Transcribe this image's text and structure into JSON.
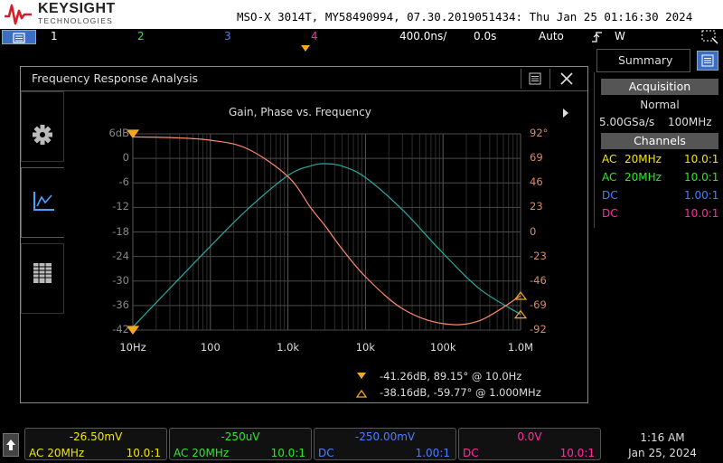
{
  "header": {
    "brand": "KEYSIGHT",
    "brand_sub": "TECHNOLOGIES",
    "title_line": "MSO-X 3014T, MY58490994, 07.30.2019051434: Thu Jan 25 01:16:30 2024"
  },
  "channel_bar": {
    "channels": [
      {
        "num": "1",
        "color": "#f2e700"
      },
      {
        "num": "2",
        "color": "#2ee62e"
      },
      {
        "num": "3",
        "color": "#4a7fff"
      },
      {
        "num": "4",
        "color": "#ff2ea0"
      }
    ],
    "timebase": "400.0ns/",
    "delay": "0.0s",
    "trigger_mode": "Auto",
    "trigger_source": "W"
  },
  "fra": {
    "title": "Frequency Response Analysis",
    "plot_title": "Gain, Phase vs. Frequency",
    "gain_ticks": [
      "6dB",
      "0",
      "-6",
      "-12",
      "-18",
      "-24",
      "-30",
      "-36",
      "-42"
    ],
    "phase_ticks": [
      "92°",
      "69",
      "46",
      "23",
      "0",
      "-23",
      "-46",
      "-69",
      "-92"
    ],
    "freq_ticks": [
      "10Hz",
      "100",
      "1.0k",
      "10k",
      "100k",
      "1.0M"
    ],
    "cursor1": "-41.26dB, 89.15° @ 10.0Hz",
    "cursor2": "-38.16dB, -59.77° @ 1.000MHz"
  },
  "chart_data": {
    "type": "line",
    "title": "Gain, Phase vs. Frequency",
    "x_scale": "log",
    "xlim": [
      10,
      1000000
    ],
    "ylim_gain_db": [
      -42,
      6
    ],
    "ylim_phase_deg": [
      -92,
      92
    ],
    "grid": true,
    "series": [
      {
        "axis": "gain",
        "color": "#2aa9a0",
        "x": [
          10,
          30,
          100,
          300,
          1000,
          2000,
          3000,
          5000,
          10000,
          30000,
          100000,
          300000,
          1000000
        ],
        "values": [
          -41.26,
          -31.8,
          -21.5,
          -12.5,
          -4.2,
          -1.8,
          -1.3,
          -1.9,
          -4.7,
          -12.6,
          -23.2,
          -32.0,
          -38.16
        ]
      },
      {
        "axis": "phase",
        "color": "#ff8a70",
        "x": [
          10,
          30,
          100,
          300,
          1000,
          2000,
          3000,
          5000,
          10000,
          30000,
          100000,
          300000,
          1000000
        ],
        "values": [
          89.15,
          88.5,
          86,
          78,
          52,
          22,
          6,
          -16,
          -42,
          -72,
          -86,
          -83,
          -59.77
        ]
      }
    ]
  },
  "summary": {
    "tab_label": "Summary",
    "acquisition_header": "Acquisition",
    "acq_mode": "Normal",
    "acq_rate": "5.00GSa/s",
    "acq_bw": "100MHz",
    "channels_header": "Channels",
    "channels": [
      {
        "coupling": "AC",
        "bw": "20MHz",
        "atten": "10.0:1",
        "color": "#f2e700"
      },
      {
        "coupling": "AC",
        "bw": "20MHz",
        "atten": "10.0:1",
        "color": "#2ee62e"
      },
      {
        "coupling": "DC",
        "bw": "",
        "atten": "1.00:1",
        "color": "#4a7fff"
      },
      {
        "coupling": "DC",
        "bw": "",
        "atten": "10.0:1",
        "color": "#ff2ea0"
      }
    ]
  },
  "footer": {
    "channels": [
      {
        "value": "-26.50mV",
        "coupling": "AC 20MHz",
        "atten": "10.0:1",
        "color": "#f2e700"
      },
      {
        "value": "-250uV",
        "coupling": "AC 20MHz",
        "atten": "10.0:1",
        "color": "#2ee62e"
      },
      {
        "value": "-250.00mV",
        "coupling": "DC",
        "atten": "1.00:1",
        "color": "#4a7fff"
      },
      {
        "value": "0.0V",
        "coupling": "DC",
        "atten": "10.0:1",
        "color": "#ff2ea0"
      }
    ],
    "time": "1:16 AM",
    "date": "Jan 25, 2024"
  }
}
